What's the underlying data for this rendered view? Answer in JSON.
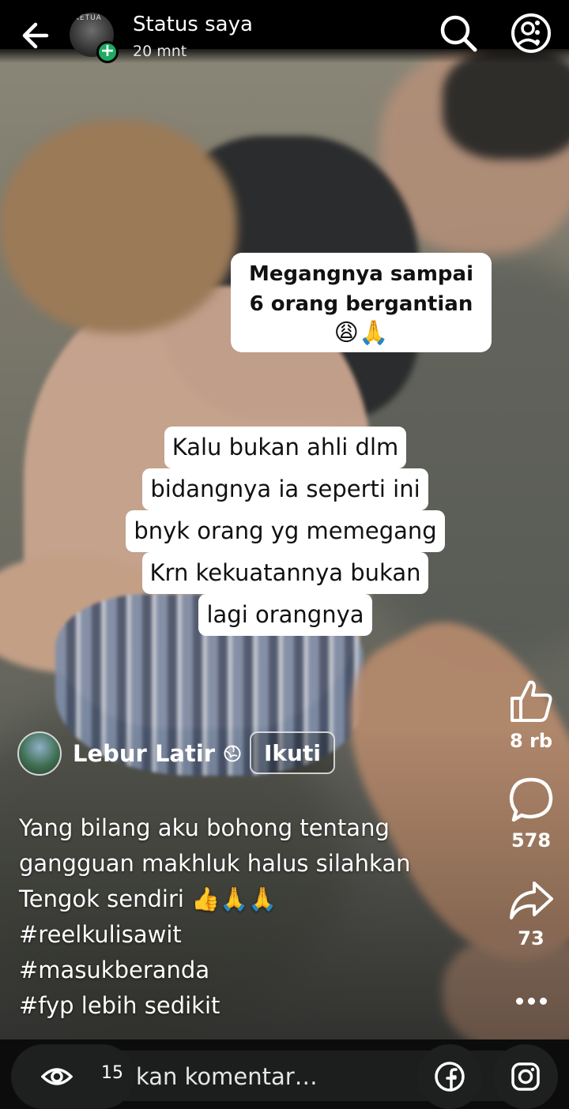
{
  "header": {
    "title": "Status saya",
    "time": "20 mnt",
    "avatar_label": "KETUA",
    "add_badge": "+"
  },
  "stickers": {
    "top": {
      "lines": [
        "Megangnya sampai",
        "6 orang bergantian"
      ],
      "emoji": "😩🙏"
    },
    "middle": {
      "lines": [
        "Kalu bukan ahli dlm",
        "bidangnya ia seperti ini",
        "bnyk orang yg memegang",
        "Krn kekuatannya bukan",
        "lagi orangnya"
      ]
    }
  },
  "reel": {
    "author": "Lebur Latir",
    "follow_label": "Ikuti",
    "caption_lines": [
      "Yang bilang aku bohong tentang",
      "gangguan makhluk halus silahkan",
      "Tengok sendiri 👍🙏🙏",
      "#reelkulisawit",
      "#masukberanda",
      "#fyp lebih sedikit"
    ],
    "likes": "8 rb",
    "comments": "578",
    "shares": "73"
  },
  "bottom_bar": {
    "views": "15",
    "comment_placeholder": "kan komentar…"
  },
  "icons": {
    "back": "arrow-left-icon",
    "search": "search-icon",
    "more": "more-options-icon",
    "like": "thumbs-up-icon",
    "comment": "comment-bubble-icon",
    "share": "share-arrow-icon",
    "views": "eye-icon",
    "facebook": "facebook-icon",
    "instagram": "instagram-icon"
  },
  "colors": {
    "accent_green": "#1daa61",
    "bar_background": "#0c0c0c"
  }
}
